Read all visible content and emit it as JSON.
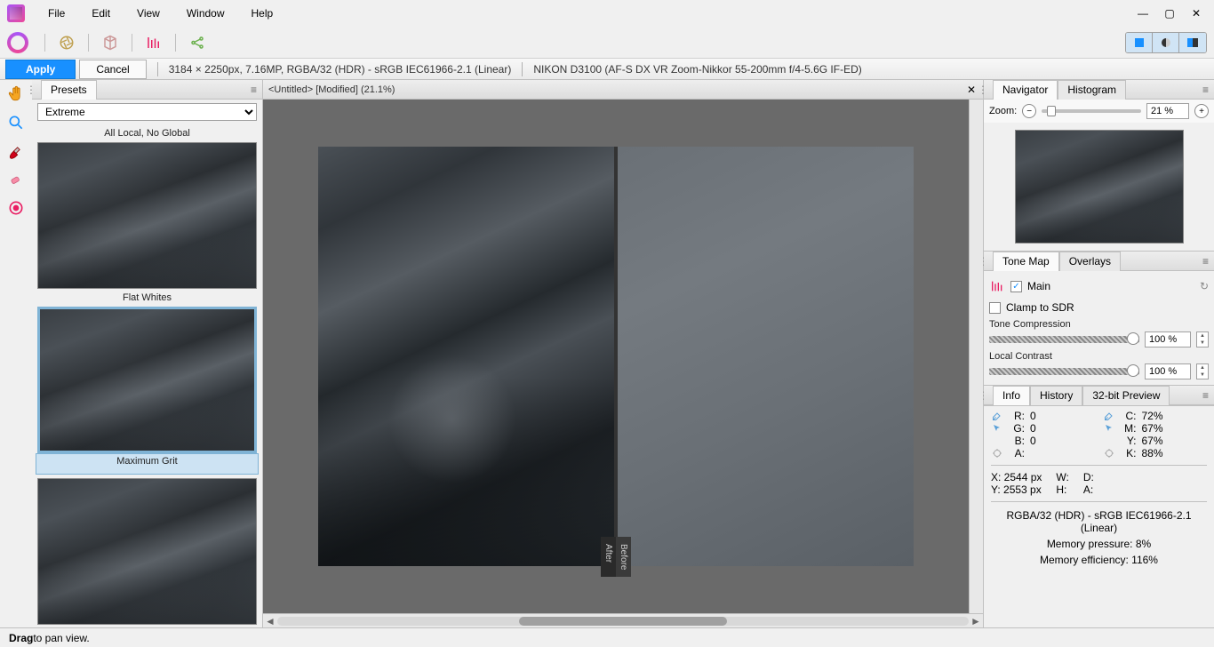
{
  "menu": {
    "items": [
      "File",
      "Edit",
      "View",
      "Window",
      "Help"
    ]
  },
  "buttons": {
    "apply": "Apply",
    "cancel": "Cancel"
  },
  "doc_info": {
    "size": "3184 × 2250px, 7.16MP, RGBA/32 (HDR) - sRGB IEC61966-2.1 (Linear)",
    "camera": "NIKON D3100 (AF-S DX VR Zoom-Nikkor 55-200mm f/4-5.6G IF-ED)"
  },
  "presets": {
    "tab": "Presets",
    "dropdown": "Extreme",
    "items": [
      {
        "label": "All Local, No Global",
        "selected": false
      },
      {
        "label": "Flat Whites",
        "selected": false
      },
      {
        "label": "Maximum Grit",
        "selected": true
      },
      {
        "label": "",
        "selected": false
      }
    ]
  },
  "document": {
    "title": "<Untitled> [Modified] (21.1%)",
    "split": {
      "left": "After",
      "right": "Before"
    }
  },
  "navigator": {
    "tabs": [
      "Navigator",
      "Histogram"
    ],
    "active": 0,
    "zoom_label": "Zoom:",
    "zoom_value": "21 %"
  },
  "tonemap": {
    "tabs": [
      "Tone Map",
      "Overlays"
    ],
    "active": 0,
    "main_label": "Main",
    "main_checked": true,
    "clamp_label": "Clamp to SDR",
    "clamp_checked": false,
    "controls": [
      {
        "label": "Tone Compression",
        "value": "100 %"
      },
      {
        "label": "Local Contrast",
        "value": "100 %"
      }
    ]
  },
  "info": {
    "tabs": [
      "Info",
      "History",
      "32-bit Preview"
    ],
    "active": 0,
    "rgba": {
      "R": "0",
      "G": "0",
      "B": "0",
      "A": ""
    },
    "cmyk": {
      "C": "72%",
      "M": "67%",
      "Y": "67%",
      "K": "88%"
    },
    "coords": {
      "X": "2544 px",
      "Y": "2553 px",
      "W": "",
      "H": "",
      "D": "",
      "A": ""
    },
    "footer": [
      "RGBA/32 (HDR) - sRGB IEC61966-2.1 (Linear)",
      "Memory pressure: 8%",
      "Memory efficiency: 116%"
    ]
  },
  "status": {
    "bold": "Drag",
    "rest": " to pan view."
  }
}
